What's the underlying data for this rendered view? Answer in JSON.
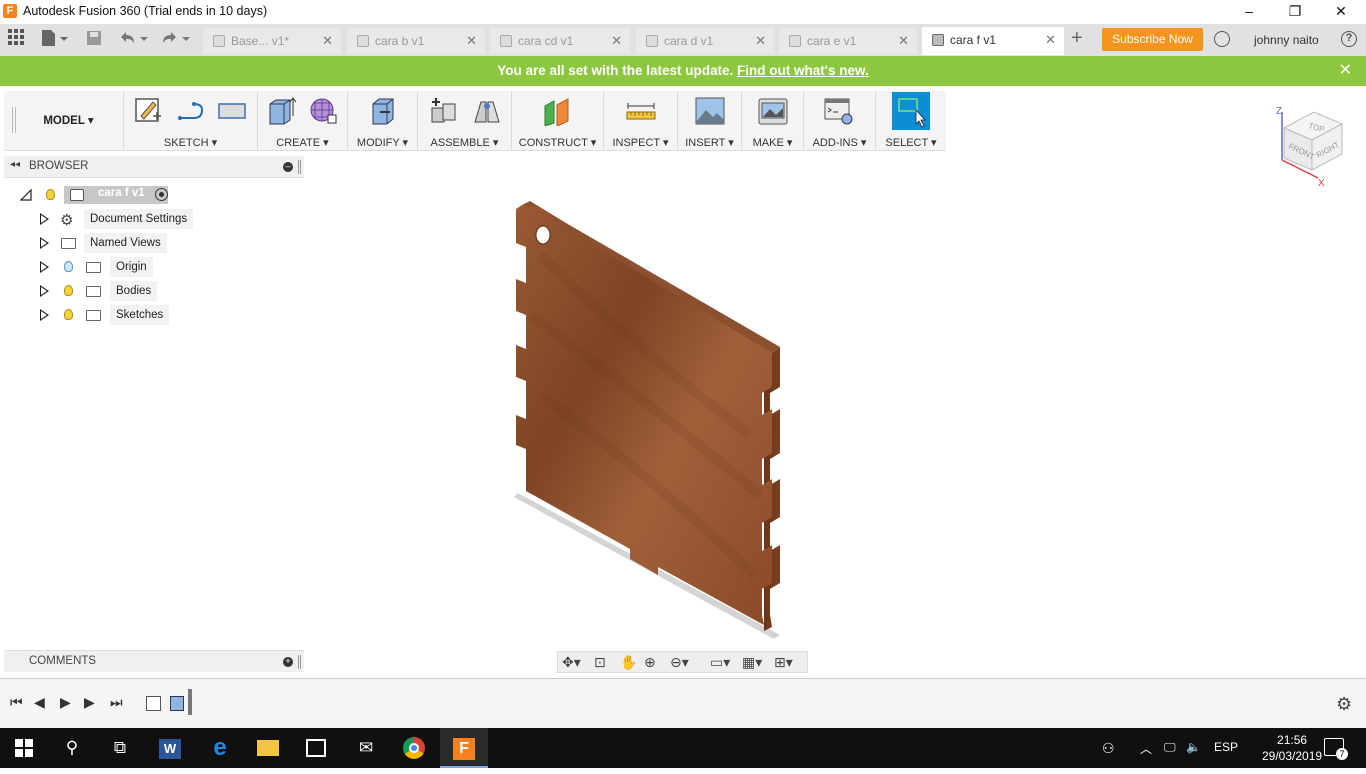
{
  "window": {
    "title": "Autodesk Fusion 360 (Trial ends in 10 days)",
    "min": "–",
    "max": "❐",
    "close": "✕"
  },
  "tabs": [
    {
      "label": "Base... v1*"
    },
    {
      "label": "cara b v1"
    },
    {
      "label": "cara cd v1"
    },
    {
      "label": "cara d v1"
    },
    {
      "label": "cara e v1"
    },
    {
      "label": "cara f v1"
    }
  ],
  "tab_close": "✕",
  "header": {
    "subscribe": "Subscribe Now",
    "user": "johnny naito",
    "help": "?"
  },
  "notification": {
    "text": "You are all set with the latest update.",
    "link": "Find out what's new.",
    "close": "✕"
  },
  "toolbar": {
    "model": "MODEL ▾",
    "groups": [
      {
        "label": "SKETCH ▾"
      },
      {
        "label": "CREATE ▾"
      },
      {
        "label": "MODIFY ▾"
      },
      {
        "label": "ASSEMBLE ▾"
      },
      {
        "label": "CONSTRUCT ▾"
      },
      {
        "label": "INSPECT ▾"
      },
      {
        "label": "INSERT ▾"
      },
      {
        "label": "MAKE ▾"
      },
      {
        "label": "ADD-INS ▾"
      },
      {
        "label": "SELECT ▾"
      }
    ]
  },
  "browser": {
    "collapse": "◂◂",
    "title": "BROWSER",
    "root": "cara f v1",
    "items": [
      {
        "label": "Document Settings"
      },
      {
        "label": "Named Views"
      },
      {
        "label": "Origin"
      },
      {
        "label": "Bodies"
      },
      {
        "label": "Sketches"
      }
    ]
  },
  "comments": {
    "title": "COMMENTS"
  },
  "viewcube": {
    "top": "TOP",
    "front": "FRONT",
    "right": "RIGHT",
    "z": "Z",
    "x": "X"
  },
  "taskbar": {
    "lang": "ESP",
    "time": "21:56",
    "date": "29/03/2019",
    "notif_count": "7"
  },
  "colors": {
    "notification": "#8dc63f",
    "subscribe": "#f7941d",
    "select_active": "#0a8fd6",
    "wood": "#8a4a26"
  }
}
